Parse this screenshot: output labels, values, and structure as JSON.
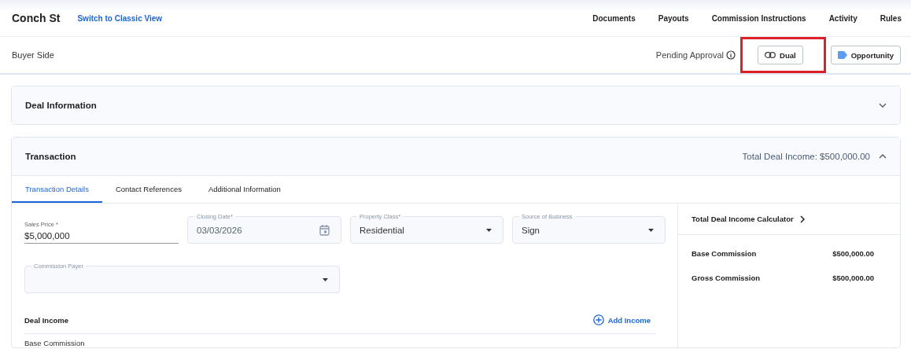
{
  "header": {
    "title": "Conch St",
    "classic_link": "Switch to Classic View",
    "nav": [
      {
        "label": "Documents"
      },
      {
        "label": "Payouts"
      },
      {
        "label": "Commission Instructions"
      },
      {
        "label": "Activity"
      },
      {
        "label": "Rules"
      }
    ]
  },
  "status_bar": {
    "side": "Buyer Side",
    "status": "Pending Approval",
    "tags": [
      {
        "kind": "link",
        "label": "Dual",
        "highlighted": true
      },
      {
        "kind": "tag",
        "label": "Opportunity",
        "highlighted": false
      }
    ]
  },
  "sections": [
    {
      "title": "Deal Information",
      "expanded": false
    },
    {
      "title": "Transaction",
      "expanded": true,
      "summary": "Total Deal Income: $500,000.00"
    }
  ],
  "transaction": {
    "tabs": [
      {
        "label": "Transaction Details",
        "selected": true
      },
      {
        "label": "Contact References",
        "selected": false
      },
      {
        "label": "Additional Information",
        "selected": false
      }
    ],
    "fields": [
      {
        "kind": "text",
        "label": "Sales Price *",
        "value": "$5,000,000"
      },
      {
        "kind": "date",
        "label": "Closing Date*",
        "value": "03/03/2026"
      },
      {
        "kind": "select",
        "label": "Property Class*",
        "value": "Residential"
      },
      {
        "kind": "select",
        "label": "Source of Business",
        "value": "Sign"
      },
      {
        "kind": "select",
        "label": "Commission Payer",
        "wide": true
      }
    ],
    "deal_income": {
      "title": "Deal Income",
      "add_button": "Add Income",
      "rows": [
        "Base Commission"
      ]
    },
    "calculator": {
      "title": "Total Deal Income Calculator",
      "rows": [
        {
          "label": "Base Commission",
          "value": "$500,000.00"
        },
        {
          "label": "Gross Commission",
          "value": "$500,000.00"
        }
      ]
    }
  }
}
